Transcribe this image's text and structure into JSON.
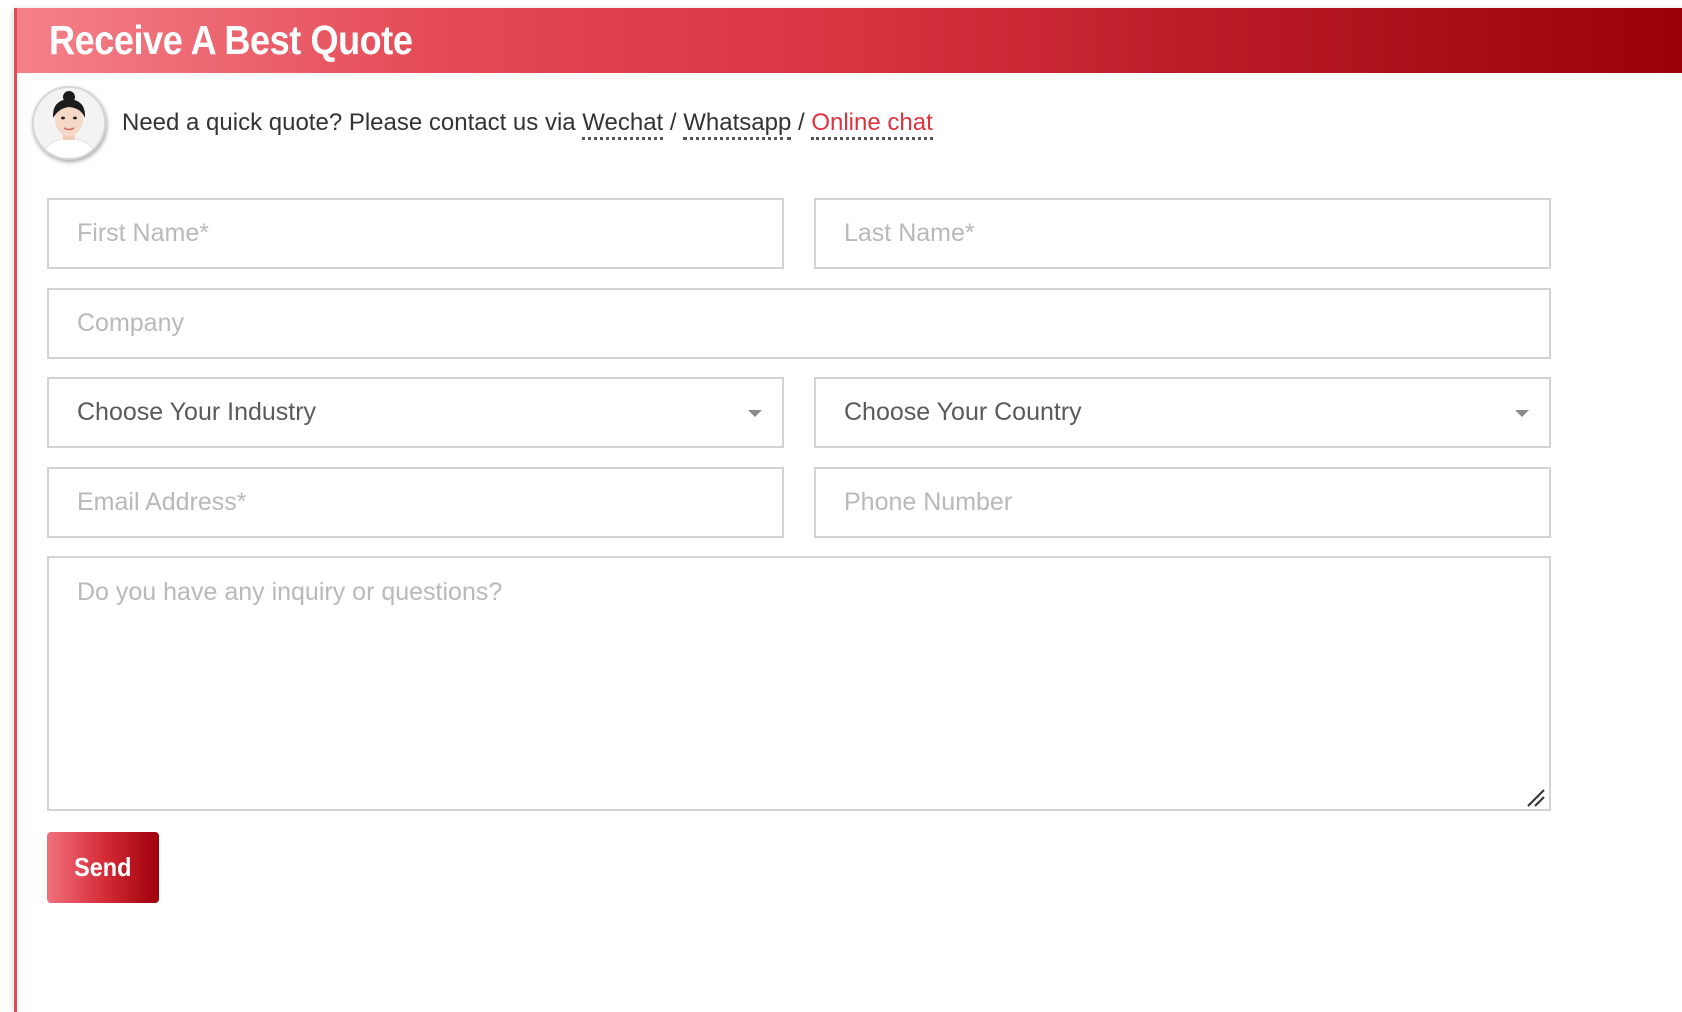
{
  "header": {
    "title": "Receive A Best Quote"
  },
  "contact": {
    "intro": "Need a quick quote? Please contact us via",
    "wechat_label": "Wechat",
    "whatsapp_label": "Whatsapp",
    "chat_label": "Online chat",
    "separator": "/"
  },
  "form": {
    "first_name_placeholder": "First Name*",
    "last_name_placeholder": "Last Name*",
    "company_placeholder": "Company",
    "industry_selected": "Choose Your Industry",
    "country_selected": "Choose Your Country",
    "email_placeholder": "Email Address*",
    "phone_placeholder": "Phone Number",
    "message_placeholder": "Do you have any inquiry or questions?",
    "send_label": "Send"
  },
  "colors": {
    "accent": "#e0323e",
    "header_gradient_start": "#f4818a",
    "header_gradient_end": "#9a0008"
  },
  "icons": {
    "select_caret": "chevron-down-icon",
    "resize": "resize-grip-icon",
    "avatar": "avatar-photo"
  }
}
